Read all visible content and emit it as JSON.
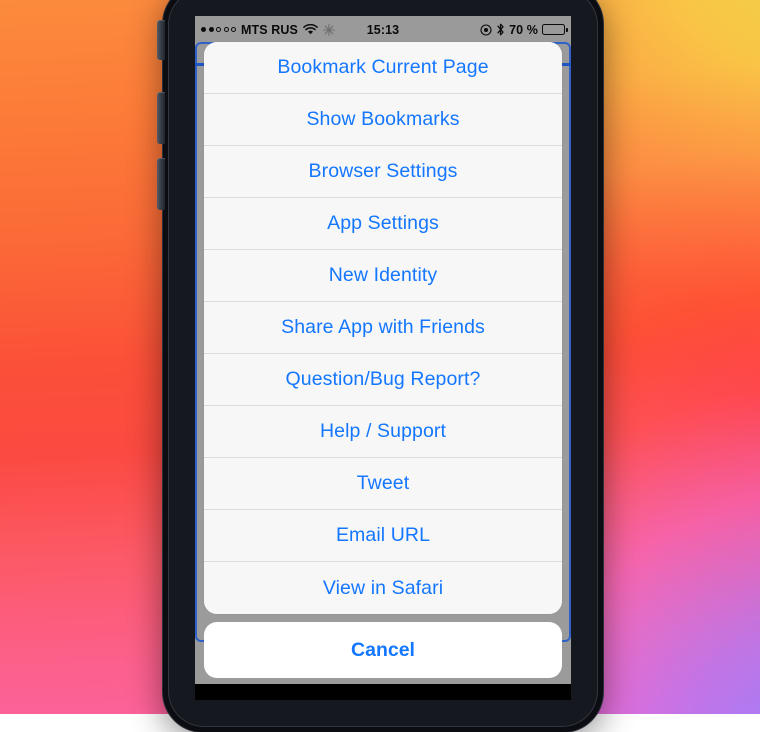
{
  "device": {
    "name": "iphone-device",
    "side_buttons": [
      "mute-switch",
      "volume-up-button",
      "volume-down-button"
    ]
  },
  "status_bar": {
    "signal_dots_filled": 2,
    "signal_dots_total": 5,
    "carrier": "MTS RUS",
    "wifi_icon": "wifi-icon",
    "snowflake_icon": "snowflake-icon",
    "time": "15:13",
    "location_icon": "location-services-icon",
    "bluetooth_icon": "bluetooth-icon",
    "battery_percent": "70 %",
    "battery_level": 70,
    "background_color": "#9a9a9a"
  },
  "browser": {
    "progress_bar_color": "#1b56c4",
    "focus_frame_color": "#2f61c9"
  },
  "action_sheet": {
    "tint_color": "#1477ff",
    "items": [
      {
        "label": "Bookmark Current Page",
        "name": "sheet-item-bookmark-current-page"
      },
      {
        "label": "Show Bookmarks",
        "name": "sheet-item-show-bookmarks"
      },
      {
        "label": "Browser Settings",
        "name": "sheet-item-browser-settings"
      },
      {
        "label": "App Settings",
        "name": "sheet-item-app-settings"
      },
      {
        "label": "New Identity",
        "name": "sheet-item-new-identity"
      },
      {
        "label": "Share App with Friends",
        "name": "sheet-item-share-app-with-friends"
      },
      {
        "label": "Question/Bug Report?",
        "name": "sheet-item-question-bug-report"
      },
      {
        "label": "Help / Support",
        "name": "sheet-item-help-support"
      },
      {
        "label": "Tweet",
        "name": "sheet-item-tweet"
      },
      {
        "label": "Email URL",
        "name": "sheet-item-email-url"
      },
      {
        "label": "View in Safari",
        "name": "sheet-item-view-in-safari"
      }
    ],
    "cancel_label": "Cancel"
  },
  "wallpaper": {
    "top_left_color": "#fc8b3d",
    "bottom_left_color": "#fc63a0",
    "top_right_color": "#e7d646",
    "mid_right_color": "#ff3a28",
    "bottom_right_color": "#9a82ff"
  }
}
